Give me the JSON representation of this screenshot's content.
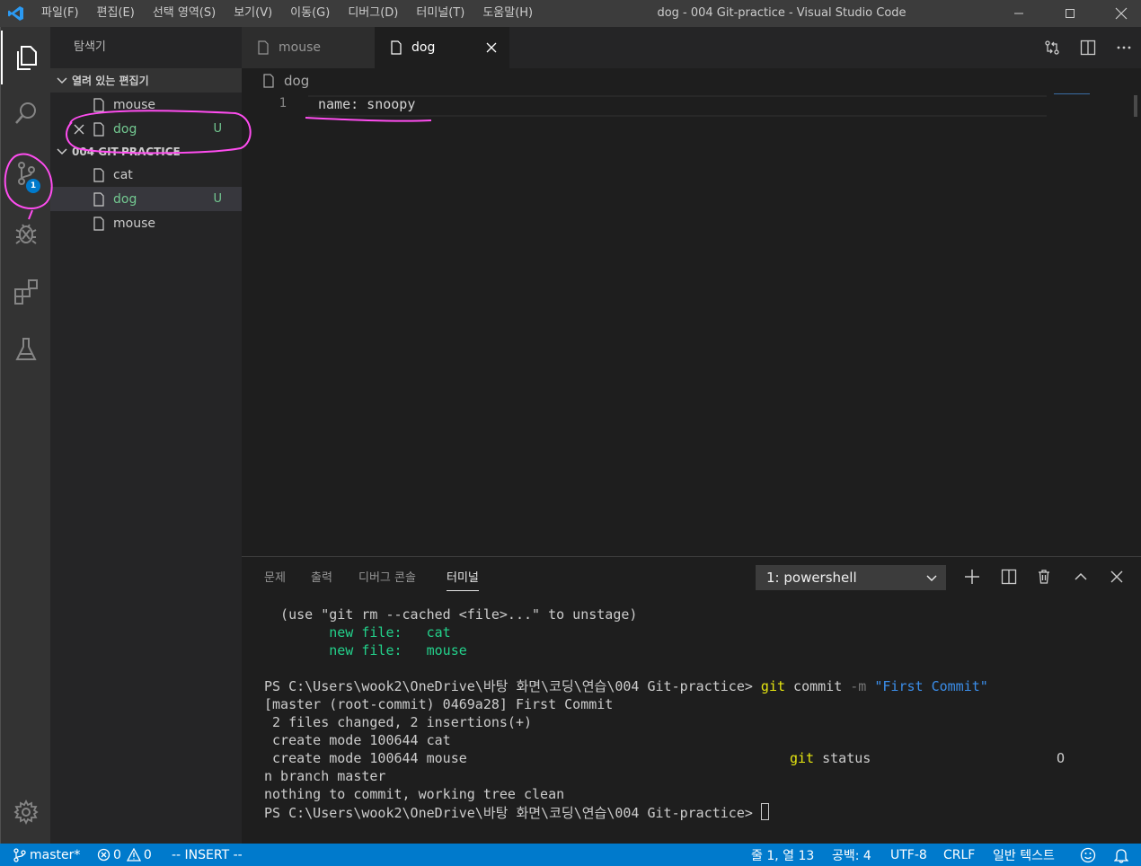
{
  "window": {
    "title": "dog - 004 Git-practice - Visual Studio Code"
  },
  "menu": [
    "파일(F)",
    "편집(E)",
    "선택 영역(S)",
    "보기(V)",
    "이동(G)",
    "디버그(D)",
    "터미널(T)",
    "도움말(H)"
  ],
  "sidebar": {
    "title": "탐색기",
    "open_editors": {
      "header": "열려 있는 편집기",
      "items": [
        {
          "name": "mouse",
          "status": ""
        },
        {
          "name": "dog",
          "status": "U"
        }
      ]
    },
    "folder": {
      "header": "004 GIT-PRACTICE",
      "items": [
        {
          "name": "cat",
          "status": ""
        },
        {
          "name": "dog",
          "status": "U"
        },
        {
          "name": "mouse",
          "status": ""
        }
      ]
    }
  },
  "activity": {
    "scm_badge": "1"
  },
  "tabs": [
    {
      "label": "mouse"
    },
    {
      "label": "dog"
    }
  ],
  "breadcrumb": "dog",
  "editor": {
    "line_number": "1",
    "code": "name: snoopy"
  },
  "panel": {
    "tabs": [
      "문제",
      "출력",
      "디버그 콘솔",
      "터미널"
    ],
    "terminal_select": "1: powershell",
    "lines": {
      "l1": "  (use \"git rm --cached <file>...\" to unstage)",
      "l2_indent": "        ",
      "l2": "new file:   cat",
      "l3": "new file:   mouse",
      "l5_prompt": "PS C:\\Users\\wook2\\OneDrive\\바탕 화면\\코딩\\연습\\004 Git-practice> ",
      "l5_git": "git",
      "l5_cmd": " commit ",
      "l5_flag": "-m",
      "l5_msg": " \"First Commit\"",
      "l6": "[master (root-commit) 0469a28] First Commit",
      "l7": " 2 files changed, 2 insertions(+)",
      "l8": " create mode 100644 cat",
      "l9": " create mode 100644 mouse",
      "l9_git": "git",
      "l9_status": " status",
      "l9_o": "O",
      "l10": "n branch master",
      "l11": "nothing to commit, working tree clean",
      "l12_prompt": "PS C:\\Users\\wook2\\OneDrive\\바탕 화면\\코딩\\연습\\004 Git-practice> "
    }
  },
  "statusbar": {
    "branch": "master*",
    "errors": "0",
    "warnings": "0",
    "mode": "-- INSERT --",
    "position": "줄 1, 열 13",
    "spaces": "공백: 4",
    "encoding": "UTF-8",
    "eol": "CRLF",
    "language": "일반 텍스트"
  },
  "colors": {
    "accent": "#007acc",
    "untracked": "#73c991",
    "annotation": "#ff4df0"
  }
}
